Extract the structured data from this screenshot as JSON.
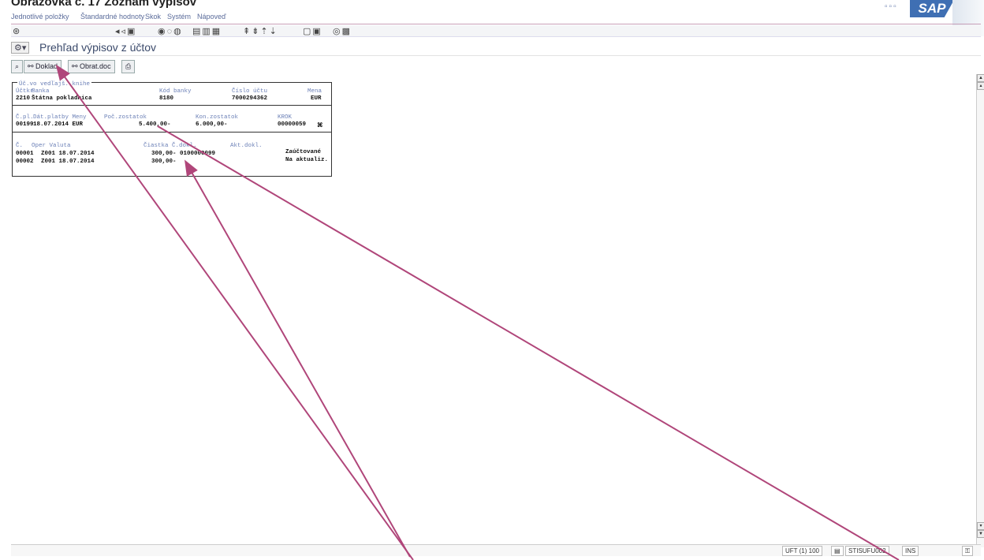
{
  "caption": "Obrazovka č. 17 Zoznam výpisov",
  "menu": [
    "Jednotlivé položky",
    "Štandardné hodnoty",
    "Skok",
    "Systém",
    "Nápoveď"
  ],
  "brand": {
    "logo_text": "SAP",
    "accent": "#3f6fb3"
  },
  "title": "Prehľad výpisov z účtov",
  "toolbar": {
    "doklad_label": "Doklad",
    "obrat_label": "Obrat.doc"
  },
  "panel": {
    "frame_label": "Úč.vo vedľajš. knihe",
    "row1_headers": {
      "uctovny": "Účtkr",
      "banka": "Banka",
      "kod": "Kód banky",
      "cislo": "Číslo účtu",
      "mena": "Mena"
    },
    "row1_values": {
      "uctovny": "2210",
      "banka": "Štátna pokladnica",
      "kod": "8180",
      "cislo": "7000294362",
      "mena": "EUR"
    },
    "row2_headers": {
      "cpl": "Č.pl.",
      "datum": "Dát.platby Meny",
      "poc": "Poč.zostatok",
      "kon": "Kon.zostatok",
      "krok": "KROK"
    },
    "row2_values": {
      "cpl": "00199",
      "datum": "18.07.2014 EUR",
      "poc": "5.400,00-",
      "kon": "6.000,00-",
      "krok": "00000059",
      "mark": "⌘"
    },
    "row3_headers": {
      "c": "Č.",
      "oper": "Oper Valuta",
      "ciastka": "Čiastka Č.dokl.",
      "akt": "Akt.dokl."
    },
    "items": [
      {
        "c": "00001",
        "oper": "Z001 18.07.2014",
        "ciastka": "300,00- 0100000099",
        "stav": "Zaúčtované"
      },
      {
        "c": "00002",
        "oper": "Z001 18.07.2014",
        "ciastka": "300,00-",
        "stav": "Na aktualiz."
      }
    ]
  },
  "status": {
    "system": "UFT (1) 100",
    "server": "STISUFU002",
    "mode": "INS"
  },
  "colors": {
    "annotation_arrow": "#b0467a"
  }
}
